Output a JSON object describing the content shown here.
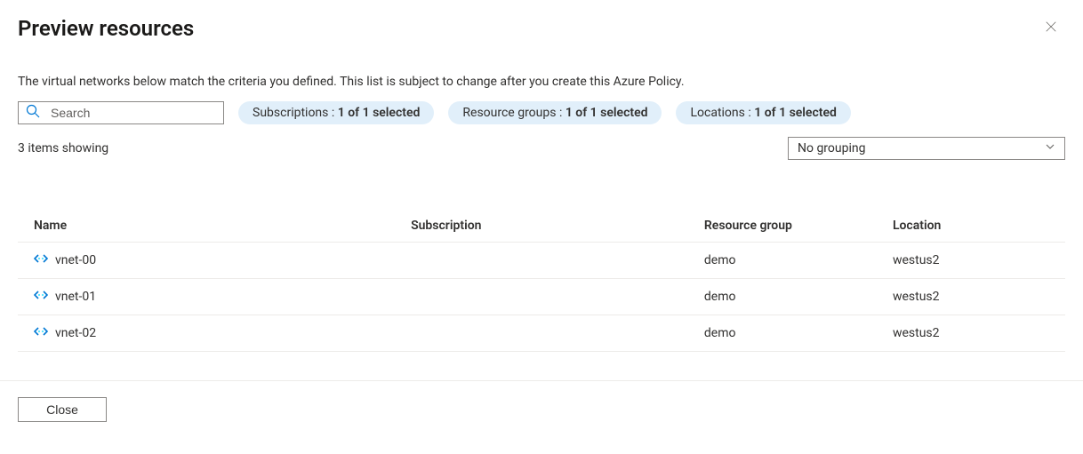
{
  "header": {
    "title": "Preview resources"
  },
  "description": "The virtual networks below match the criteria you defined. This list is subject to change after you create this Azure Policy.",
  "search": {
    "placeholder": "Search"
  },
  "filters": {
    "subs_label": "Subscriptions :",
    "subs_value": "1 of 1 selected",
    "rg_label": "Resource groups :",
    "rg_value": "1 of 1 selected",
    "loc_label": "Locations :",
    "loc_value": "1 of 1 selected"
  },
  "status": {
    "items_showing": "3 items showing"
  },
  "grouping": {
    "selected": "No grouping"
  },
  "table": {
    "headers": {
      "name": "Name",
      "subscription": "Subscription",
      "rg": "Resource group",
      "location": "Location"
    },
    "rows": [
      {
        "name": "vnet-00",
        "subscription": "",
        "rg": "demo",
        "location": "westus2"
      },
      {
        "name": "vnet-01",
        "subscription": "",
        "rg": "demo",
        "location": "westus2"
      },
      {
        "name": "vnet-02",
        "subscription": "",
        "rg": "demo",
        "location": "westus2"
      }
    ]
  },
  "footer": {
    "close": "Close"
  }
}
